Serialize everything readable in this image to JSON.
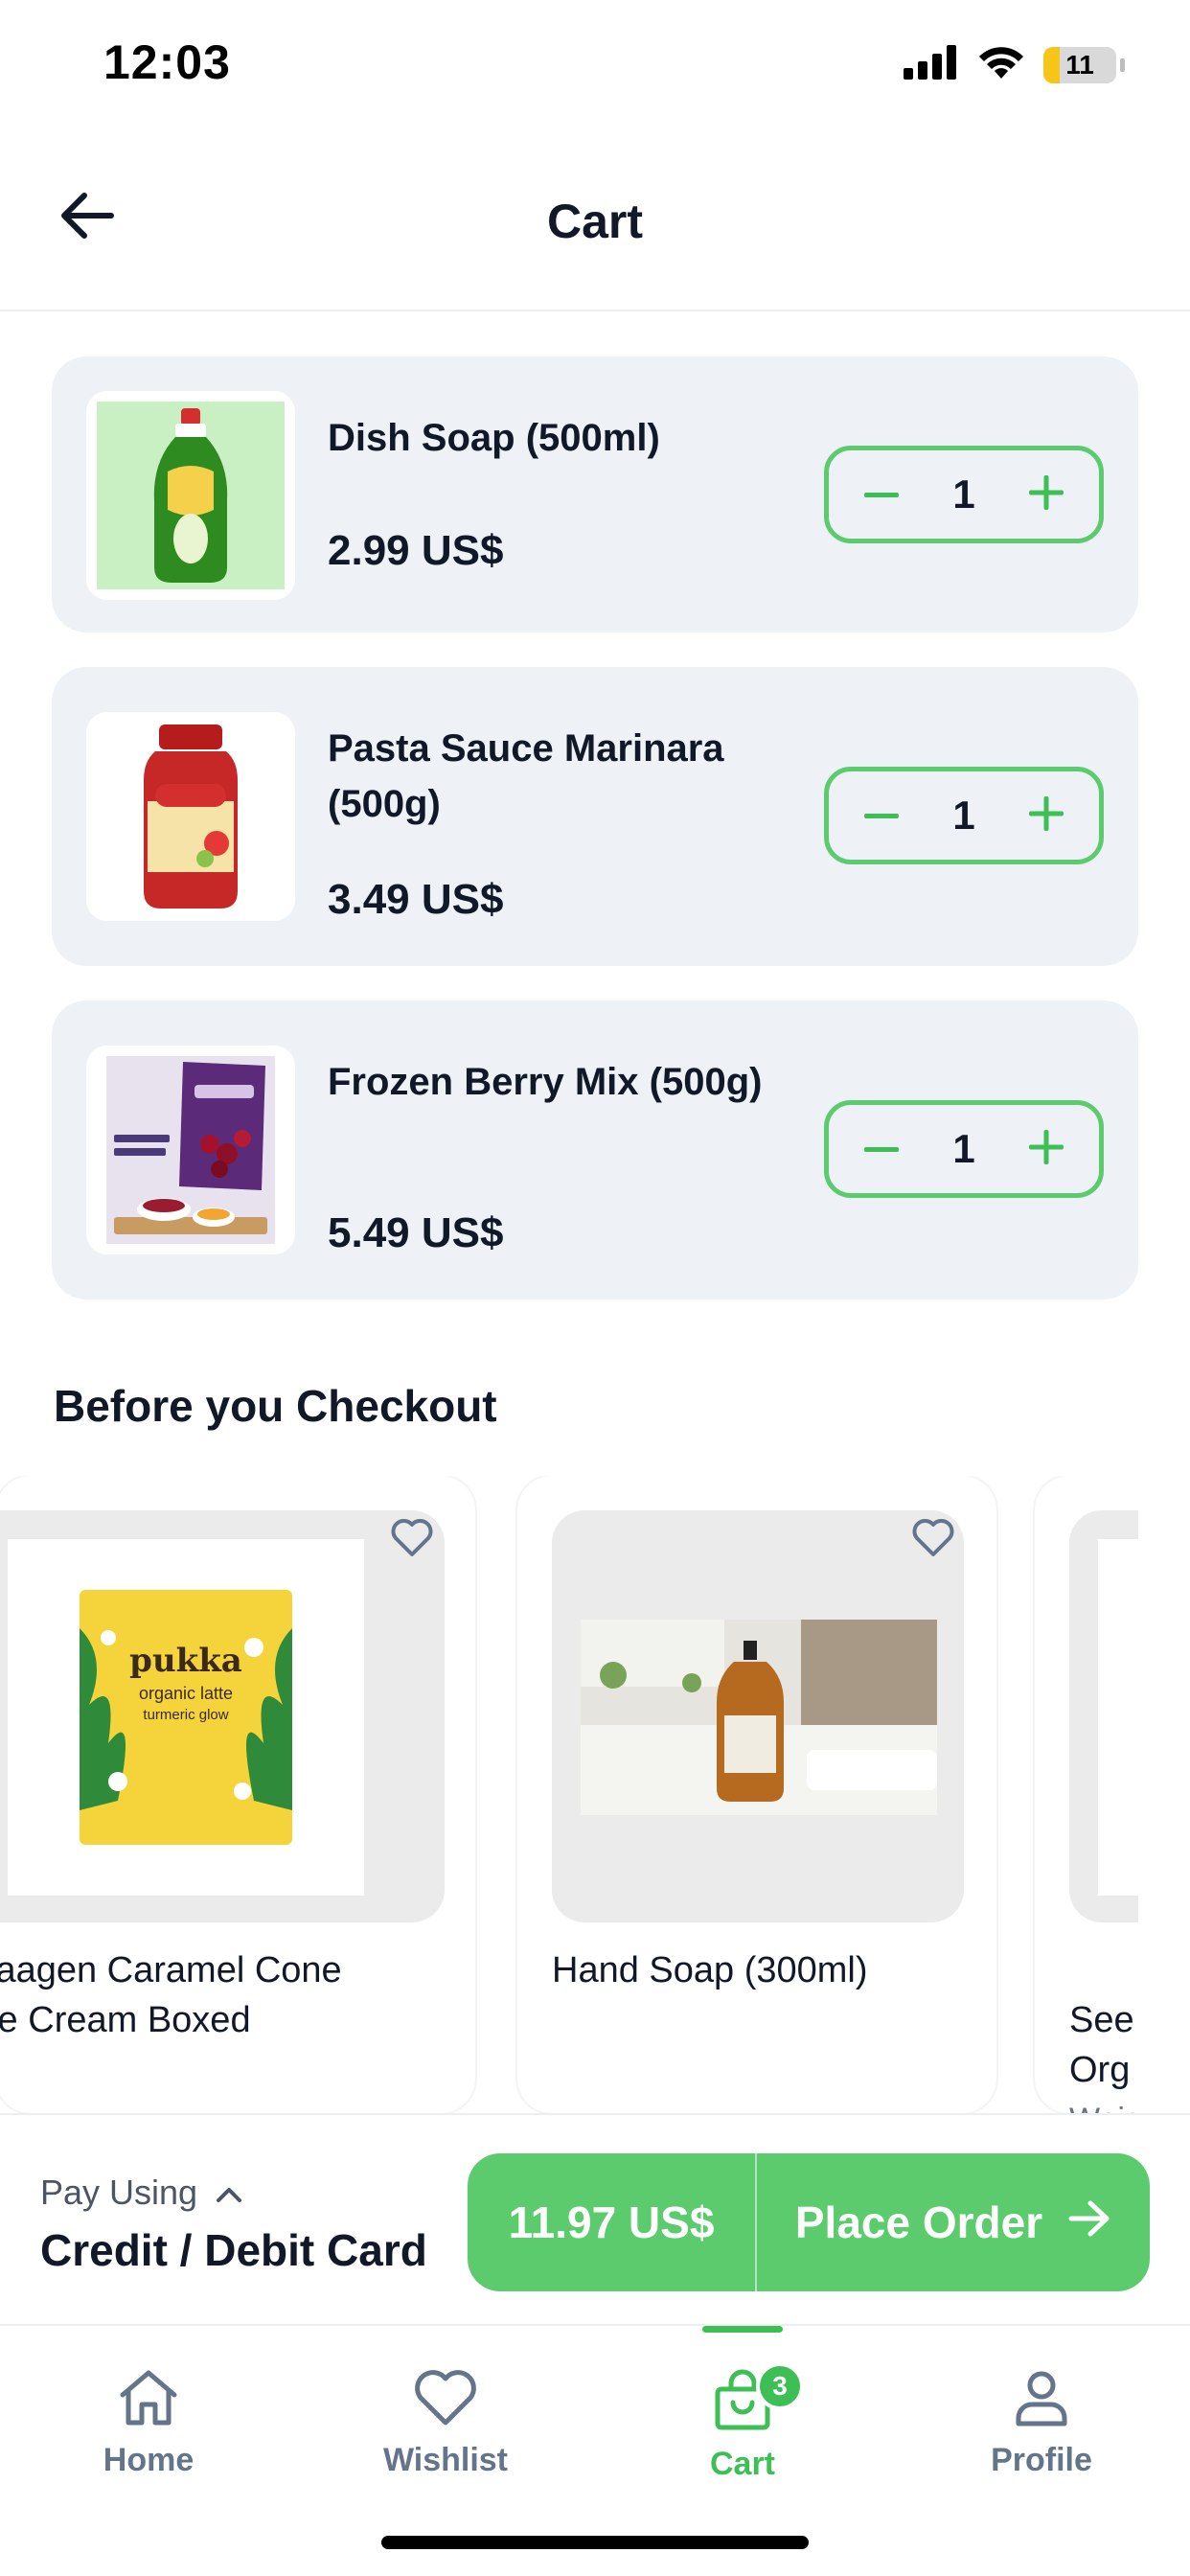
{
  "status_bar": {
    "time": "12:03",
    "battery": "11",
    "battery_level": 0.11
  },
  "header": {
    "title": "Cart"
  },
  "cart_items": [
    {
      "name": "Dish Soap (500ml)",
      "price": "2.99 US$",
      "quantity": "1"
    },
    {
      "name": "Pasta Sauce Marinara (500g)",
      "price": "3.49 US$",
      "quantity": "1"
    },
    {
      "name": "Frozen Berry Mix (500g)",
      "price": "5.49 US$",
      "quantity": "1"
    }
  ],
  "suggestions": {
    "title": "Before you Checkout",
    "items": [
      {
        "name": "Haagen  Caramel Cone\nIce Cream Boxed",
        "image_text": {
          "brand": "pukka",
          "line1": "organic latte",
          "line2": "turmeric glow"
        }
      },
      {
        "name": "Hand Soap (300ml)"
      },
      {
        "name": "See\nOrg",
        "sub": "Weig"
      }
    ]
  },
  "checkout": {
    "pay_label": "Pay Using",
    "pay_method": "Credit / Debit Card",
    "total": "11.97 US$",
    "action": "Place Order"
  },
  "nav": {
    "items": [
      {
        "label": "Home",
        "icon": "home-icon"
      },
      {
        "label": "Wishlist",
        "icon": "heart-icon"
      },
      {
        "label": "Cart",
        "icon": "cart-icon",
        "badge": "3",
        "active": true
      },
      {
        "label": "Profile",
        "icon": "user-icon"
      }
    ]
  },
  "colors": {
    "accent": "#5ccb6d",
    "nav_active": "#3dbf55",
    "card_bg": "#eef2f7",
    "text": "#111827"
  }
}
